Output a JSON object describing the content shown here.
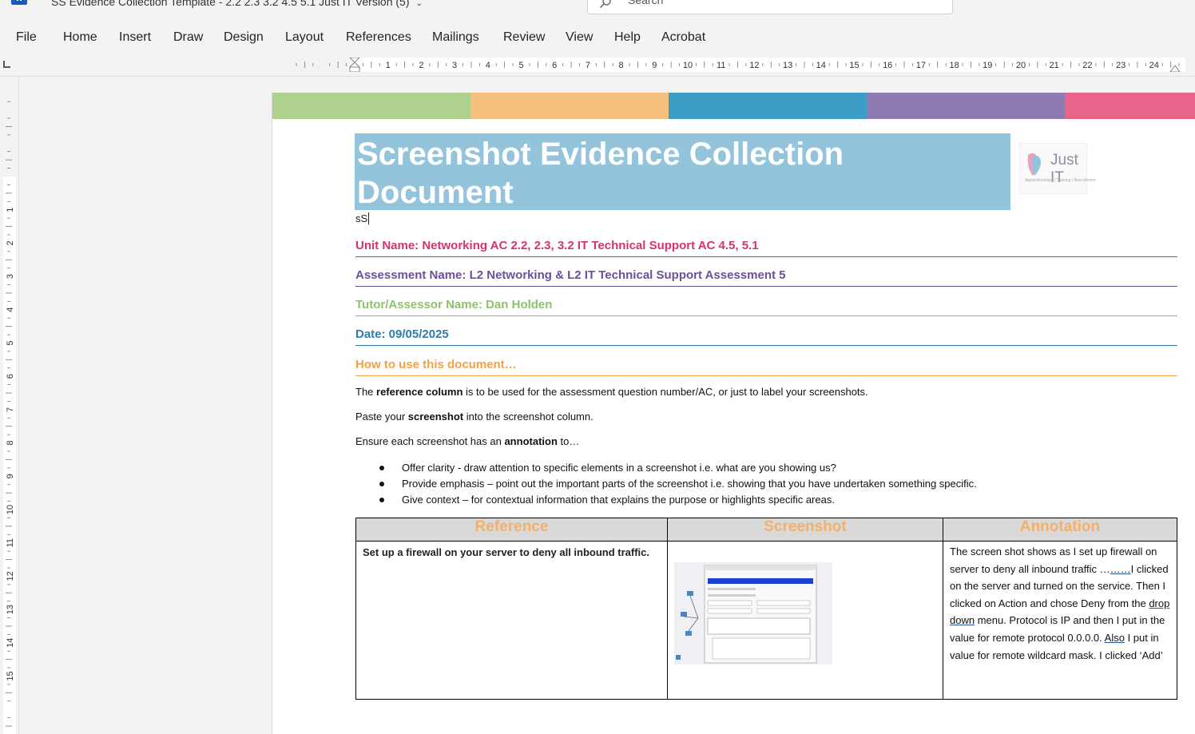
{
  "titlebar": {
    "app_icon": "word-icon",
    "document_title": "SS Evidence Collection Template - 2.2 2.3 3.2 4.5 5.1 Just IT Version (5)",
    "search_placeholder": "Search"
  },
  "ribbon": {
    "tabs": [
      "File",
      "Home",
      "Insert",
      "Draw",
      "Design",
      "Layout",
      "References",
      "Mailings",
      "Review",
      "View",
      "Help",
      "Acrobat"
    ]
  },
  "ruler": {
    "horizontal_labels": [
      "1",
      "2",
      "3",
      "4",
      "5",
      "6",
      "7",
      "8",
      "9",
      "10",
      "11",
      "12",
      "13",
      "14",
      "15",
      "16",
      "17",
      "18",
      "19",
      "20",
      "21",
      "22",
      "23",
      "24"
    ],
    "vertical_labels": [
      "1",
      "2",
      "3",
      "4",
      "5",
      "6",
      "7",
      "8",
      "9",
      "10",
      "11",
      "12",
      "13",
      "14",
      "15"
    ]
  },
  "colors": {
    "bar": [
      "#aed18f",
      "#f5bf7e",
      "#3c9dc6",
      "#8e7bb3",
      "#e8648a"
    ],
    "unit_heading": "#d9326b",
    "assessment_heading": "#6b4f9a",
    "tutor_heading": "#8dc26a",
    "date_heading": "#2d7ea8",
    "howto_heading": "#f0a24a"
  },
  "document": {
    "title": "Screenshot Evidence Collection Document",
    "logo_text": "Just IT",
    "logo_tagline": "Apprenticeships | Training | Recruitment",
    "typed_text": "sS",
    "unit_name": "Unit Name: Networking AC 2.2, 2.3, 3.2 IT Technical Support AC 4.5, 5.1",
    "assessment_name": "Assessment Name: L2 Networking & L2 IT Technical Support Assessment 5",
    "tutor_name": "Tutor/Assessor Name: Dan Holden",
    "date": "Date: 09/05/2025",
    "howto_heading": "How to use this document…",
    "para1": {
      "pre": "The ",
      "bold": "reference column",
      "post": " is to be used for the assessment question number/AC, or just to label your screenshots."
    },
    "para2": {
      "pre": "Paste your ",
      "bold": "screenshot",
      "post": " into the screenshot column."
    },
    "para3": {
      "pre": "Ensure each screenshot has an ",
      "bold": "annotation",
      "post": " to…"
    },
    "bullets": [
      "Offer clarity - draw attention to specific elements in a screenshot i.e. what are you showing us?",
      "Provide emphasis – point out the important parts of the screenshot i.e. showing that you have undertaken something specific.",
      "Give context – for contextual information that explains the purpose or highlights specific areas."
    ],
    "table": {
      "headers": [
        "Reference",
        "Screenshot",
        "Annotation"
      ],
      "reference": "Set up a firewall on your server to deny all inbound traffic.",
      "annotation_a": "The screen shot shows as I set up firewall on server to deny all inbound traffic …",
      "annotation_dots": "……",
      "annotation_b": "I clicked on the server and turned on the service. Then I clicked on Action and chose Deny from the ",
      "annotation_dropdown": "drop down",
      "annotation_c": " menu. Protocol is IP and then I put in the value for remote protocol 0.0.0.0. ",
      "annotation_also": "Also",
      "annotation_d": " I put in value for remote wildcard mask.  I clicked ‘Add’"
    }
  }
}
